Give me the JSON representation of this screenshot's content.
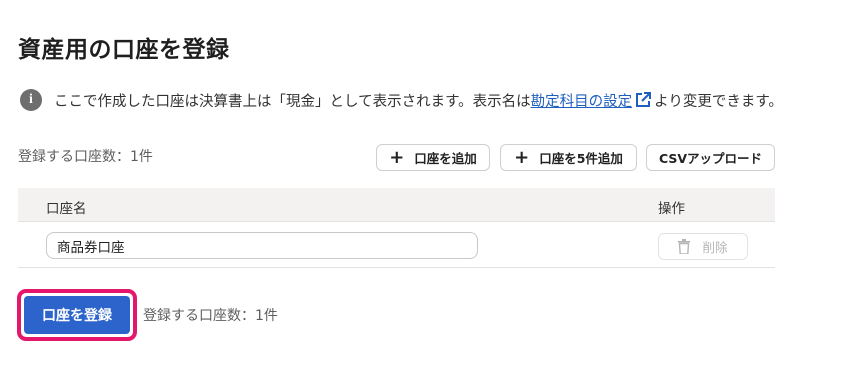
{
  "page": {
    "title": "資産用の口座を登録"
  },
  "info": {
    "text_before": "ここで作成した口座は決算書上は「現金」として表示されます。表示名は",
    "link_text": "勘定科目の設定",
    "text_after": "より変更できます。",
    "icon": "info-icon",
    "link_icon": "external-link-icon"
  },
  "toolbar": {
    "count_text": "登録する口座数：1件",
    "add_one_label": "口座を追加",
    "add_five_label": "口座を5件追加",
    "csv_upload_label": "CSVアップロード"
  },
  "table": {
    "headers": {
      "name": "口座名",
      "operation": "操作"
    },
    "rows": [
      {
        "name": "商品券口座",
        "delete_label": "削除"
      }
    ]
  },
  "footer": {
    "submit_label": "口座を登録",
    "count_text": "登録する口座数：1件"
  },
  "colors": {
    "primary": "#2c64cb",
    "highlight": "#e5176b",
    "link": "#1f5fbf"
  }
}
